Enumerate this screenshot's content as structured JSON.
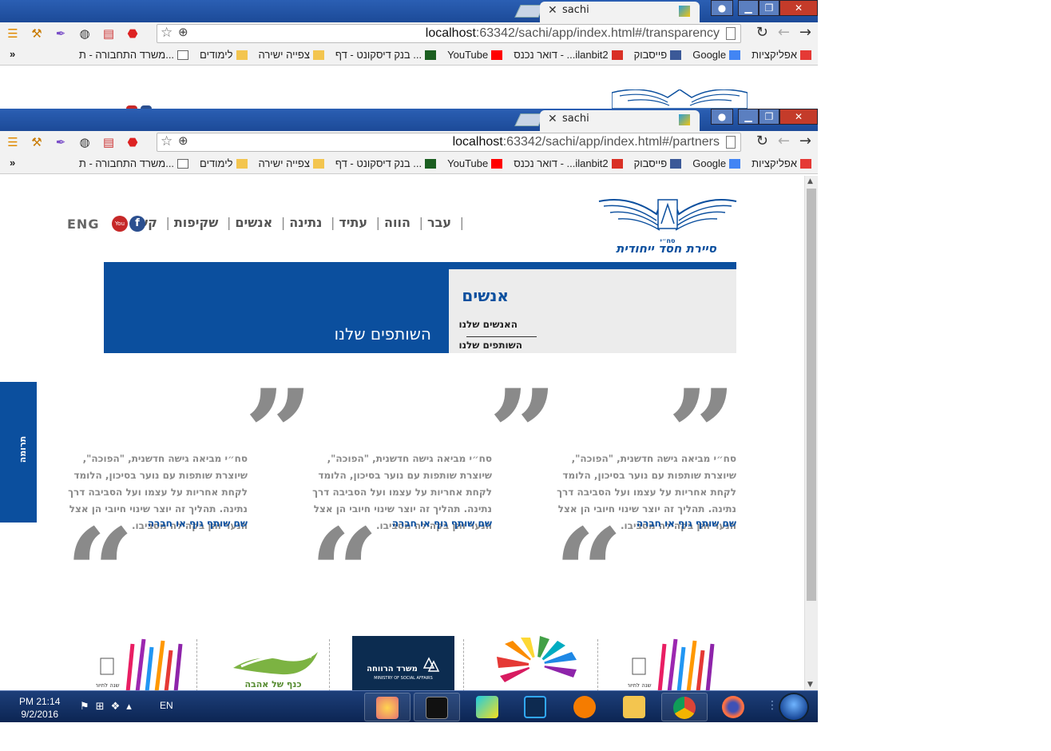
{
  "window1": {
    "tab_title": "sachi",
    "url_host": "localhost",
    "url_rest": ":63342/sachi/app/index.html#/transparency"
  },
  "window2": {
    "tab_title": "sachi",
    "url_host": "localhost",
    "url_rest": ":63342/sachi/app/index.html#/partners"
  },
  "bookmarks": {
    "more": "»",
    "items": [
      {
        "label": "אפליקציות",
        "icon": "apps-icon"
      },
      {
        "label": "Google",
        "icon": "google-icon"
      },
      {
        "label": "פייסבוק",
        "icon": "facebook-icon"
      },
      {
        "label": "דואר נכנס - ...ilanbit2",
        "icon": "gmail-icon"
      },
      {
        "label": "YouTube",
        "icon": "youtube-icon"
      },
      {
        "label": "בנק דיסקונט - דף ...",
        "icon": "bank-icon"
      },
      {
        "label": "צפייה ישירה",
        "icon": "folder-icon"
      },
      {
        "label": "לימודים",
        "icon": "folder-icon"
      },
      {
        "label": "משרד התחבורה - ת...",
        "icon": "page-icon"
      }
    ]
  },
  "site": {
    "nav": [
      "עבר",
      "הווה",
      "עתיד",
      "נתינה",
      "אנשים",
      "שקיפות",
      "קשר"
    ],
    "eng": "ENG",
    "logo_text": "סיירת חסד ייחודית",
    "logo_badge": "סח״י",
    "section_title": "אנשים",
    "sub_links": [
      "האנשים שלנו",
      "השותפים שלנו"
    ],
    "hero_title": "השותפים שלנו",
    "donate": "תרומה",
    "quotes": [
      {
        "text": "סח״י מביאה גישה חדשנית, \"הפוכה\", שיוצרת שותפות עם נוער בסיכון, הלומד לקחת אחריות על עצמו ועל הסביבה דרך נתינה. תהליך זה יוצר שינוי חיובי הן אצל הנער והן בקהילה מסביבו.",
        "name": "שם שותף גוף או חברה"
      },
      {
        "text": "סח״י מביאה גישה חדשנית, \"הפוכה\", שיוצרת שותפות עם נוער בסיכון, הלומד לקחת אחריות על עצמו ועל הסביבה דרך נתינה. תהליך זה יוצר שינוי חיובי הן אצל הנער והן בקהילה מסביבו.",
        "name": "שם שותף גוף או חברה"
      },
      {
        "text": "סח״י מביאה גישה חדשנית, \"הפוכה\", שיוצרת שותפות עם נוער בסיכון, הלומד לקחת אחריות על עצמו ועל הסביבה דרך נתינה. תהליך זה יוצר שינוי חיובי הן אצל הנער והן בקהילה מסביבו.",
        "name": "שם שותף גוף או חברה"
      }
    ],
    "logos": {
      "ministry": "משרד הרווחה",
      "ministry_en": "MINISTRY OF SOCIAL AFFAIRS",
      "kanaf": "כנף של אהבה",
      "jerusalem": "שנה לחיות"
    }
  },
  "taskbar": {
    "time": "PM 21:14",
    "date": "9/2/2016",
    "lang": "EN"
  },
  "colors": {
    "brand_blue": "#0b4f9e",
    "quote_gray": "#8a8a8a",
    "chrome_blue": "#1c4a98"
  }
}
